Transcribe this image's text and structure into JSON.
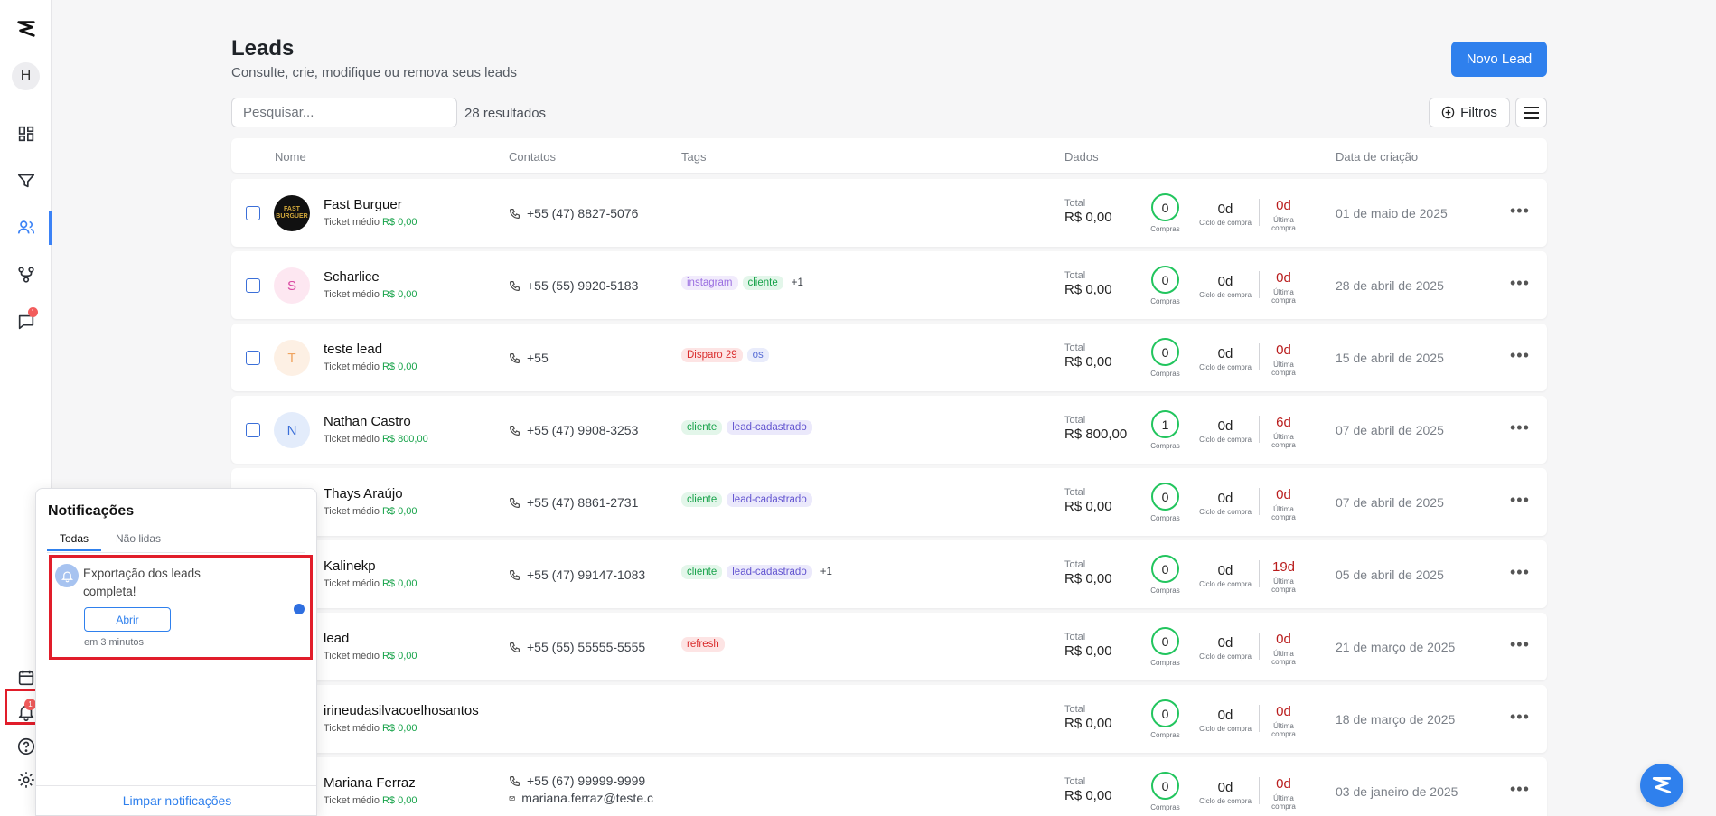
{
  "sidebar": {
    "avatar_initial": "H",
    "messages_badge": "1",
    "notifications_badge": "1"
  },
  "header": {
    "title": "Leads",
    "subtitle": "Consulte, crie, modifique ou remova seus leads",
    "new_lead_label": "Novo Lead"
  },
  "toolbar": {
    "search_placeholder": "Pesquisar...",
    "result_count": "28 resultados",
    "filters_label": "Filtros"
  },
  "table": {
    "columns": {
      "name": "Nome",
      "contacts": "Contatos",
      "tags": "Tags",
      "data": "Dados",
      "created": "Data de criação"
    },
    "labels": {
      "ticket": "Ticket médio",
      "total": "Total",
      "purchases": "Compras",
      "cycle": "Ciclo de compra",
      "last": "Última compra"
    },
    "rows": [
      {
        "name": "Fast Burguer",
        "avatar": "FAST BURGUER",
        "avatar_bg": "#111111",
        "avatar_fg": "#d4a93b",
        "ticket": "R$ 0,00",
        "phone": "+55 (47) 8827-5076",
        "email": "",
        "tags": [],
        "more": "",
        "total": "R$ 0,00",
        "purchases": "0",
        "cycle": "0d",
        "last": "0d",
        "date": "01 de maio de 2025"
      },
      {
        "name": "Scharlice",
        "avatar": "S",
        "avatar_bg": "#fde7f1",
        "avatar_fg": "#d946a0",
        "ticket": "R$ 0,00",
        "phone": "+55 (55) 9920-5183",
        "email": "",
        "tags": [
          {
            "label": "instagram",
            "bg": "#f1ebfc",
            "fg": "#9a6ee0"
          },
          {
            "label": "cliente",
            "bg": "#e3f6ea",
            "fg": "#17a34a"
          }
        ],
        "more": "+1",
        "total": "R$ 0,00",
        "purchases": "0",
        "cycle": "0d",
        "last": "0d",
        "date": "28 de abril de 2025"
      },
      {
        "name": "teste lead",
        "avatar": "T",
        "avatar_bg": "#fdf0e4",
        "avatar_fg": "#f0a460",
        "ticket": "R$ 0,00",
        "phone": "+55",
        "email": "",
        "tags": [
          {
            "label": "Disparo 29",
            "bg": "#fde4e4",
            "fg": "#d92d2d"
          },
          {
            "label": "os",
            "bg": "#e9ecfb",
            "fg": "#5a6fd6"
          }
        ],
        "more": "",
        "total": "R$ 0,00",
        "purchases": "0",
        "cycle": "0d",
        "last": "0d",
        "date": "15 de abril de 2025"
      },
      {
        "name": "Nathan Castro",
        "avatar": "N",
        "avatar_bg": "#e3ecfb",
        "avatar_fg": "#3b6fd8",
        "ticket": "R$ 800,00",
        "phone": "+55 (47) 9908-3253",
        "email": "",
        "tags": [
          {
            "label": "cliente",
            "bg": "#e3f6ea",
            "fg": "#17a34a"
          },
          {
            "label": "lead-cadastrado",
            "bg": "#ebe9fb",
            "fg": "#6355d0"
          }
        ],
        "more": "",
        "total": "R$ 800,00",
        "purchases": "1",
        "cycle": "0d",
        "last": "6d",
        "date": "07 de abril de 2025"
      },
      {
        "name": "Thays Araújo",
        "avatar": "",
        "avatar_bg": "#ffffff",
        "avatar_fg": "#ffffff",
        "ticket": "R$ 0,00",
        "phone": "+55 (47) 8861-2731",
        "email": "",
        "tags": [
          {
            "label": "cliente",
            "bg": "#e3f6ea",
            "fg": "#17a34a"
          },
          {
            "label": "lead-cadastrado",
            "bg": "#ebe9fb",
            "fg": "#6355d0"
          }
        ],
        "more": "",
        "total": "R$ 0,00",
        "purchases": "0",
        "cycle": "0d",
        "last": "0d",
        "date": "07 de abril de 2025"
      },
      {
        "name": "Kalinekp",
        "avatar": "",
        "avatar_bg": "#ffffff",
        "avatar_fg": "#ffffff",
        "ticket": "R$ 0,00",
        "phone": "+55 (47) 99147-1083",
        "email": "",
        "tags": [
          {
            "label": "cliente",
            "bg": "#e3f6ea",
            "fg": "#17a34a"
          },
          {
            "label": "lead-cadastrado",
            "bg": "#ebe9fb",
            "fg": "#6355d0"
          }
        ],
        "more": "+1",
        "total": "R$ 0,00",
        "purchases": "0",
        "cycle": "0d",
        "last": "19d",
        "date": "05 de abril de 2025"
      },
      {
        "name": "lead",
        "avatar": "",
        "avatar_bg": "#ffffff",
        "avatar_fg": "#ffffff",
        "ticket": "R$ 0,00",
        "phone": "+55 (55) 55555-5555",
        "email": "",
        "tags": [
          {
            "label": "refresh",
            "bg": "#fde4e4",
            "fg": "#d92d2d"
          }
        ],
        "more": "",
        "total": "R$ 0,00",
        "purchases": "0",
        "cycle": "0d",
        "last": "0d",
        "date": "21 de março de 2025"
      },
      {
        "name": "irineudasilvacoelhosantos",
        "avatar": "",
        "avatar_bg": "#ffffff",
        "avatar_fg": "#ffffff",
        "ticket": "R$ 0,00",
        "phone": "",
        "email": "",
        "tags": [],
        "more": "",
        "total": "R$ 0,00",
        "purchases": "0",
        "cycle": "0d",
        "last": "0d",
        "date": "18 de março de 2025"
      },
      {
        "name": "Mariana Ferraz",
        "avatar": "",
        "avatar_bg": "#ffffff",
        "avatar_fg": "#ffffff",
        "ticket": "R$ 0,00",
        "phone": "+55 (67) 99999-9999",
        "email": "mariana.ferraz@teste.c",
        "tags": [],
        "more": "",
        "total": "R$ 0,00",
        "purchases": "0",
        "cycle": "0d",
        "last": "0d",
        "date": "03 de janeiro de 2025"
      }
    ]
  },
  "notifications": {
    "title": "Notificações",
    "tab_all": "Todas",
    "tab_unread": "Não lidas",
    "item": {
      "text": "Exportação dos leads completa!",
      "open_label": "Abrir",
      "time": "em 3 minutos"
    },
    "clear_label": "Limpar notificações"
  }
}
